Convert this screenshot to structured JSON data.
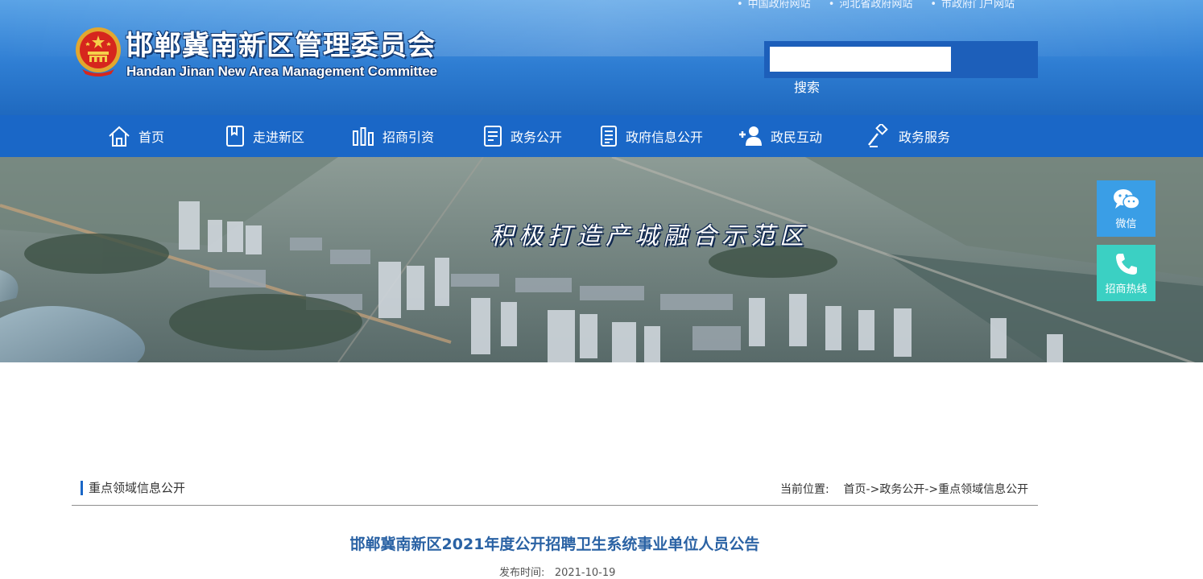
{
  "header": {
    "top_links": [
      "中国政府网站",
      "河北省政府网站",
      "市政府门户网站"
    ],
    "title_cn": "邯郸冀南新区管理委员会",
    "title_en": "Handan Jinan New Area Management Committee",
    "search": {
      "placeholder": "",
      "button_label": "搜索"
    }
  },
  "nav": {
    "items": [
      {
        "label": "首页",
        "icon": "home-icon"
      },
      {
        "label": "走进新区",
        "icon": "bookmark-icon"
      },
      {
        "label": "招商引资",
        "icon": "bar-chart-icon"
      },
      {
        "label": "政务公开",
        "icon": "document-icon"
      },
      {
        "label": "政府信息公开",
        "icon": "document-list-icon"
      },
      {
        "label": "政民互动",
        "icon": "add-user-icon"
      },
      {
        "label": "政务服务",
        "icon": "gavel-icon"
      }
    ]
  },
  "banner": {
    "slogan": "积极打造产城融合示范区"
  },
  "float_buttons": {
    "wechat_label": "微信",
    "hotline_label": "招商热线"
  },
  "content": {
    "section_title": "重点领域信息公开",
    "breadcrumb": {
      "prefix": "当前位置:",
      "items": [
        "首页",
        "政务公开",
        "重点领域信息公开"
      ],
      "separator": "->"
    },
    "article_title": "邯郸冀南新区2021年度公开招聘卫生系统事业单位人员公告",
    "publish_label": "发布时间:",
    "publish_date": "2021-10-19"
  },
  "colors": {
    "nav_bg": "#1a67c7",
    "header_bg": "#2f7ed3",
    "title_blue": "#2a62a4",
    "wechat": "#3a9ee6",
    "hotline": "#3bd0c3"
  }
}
